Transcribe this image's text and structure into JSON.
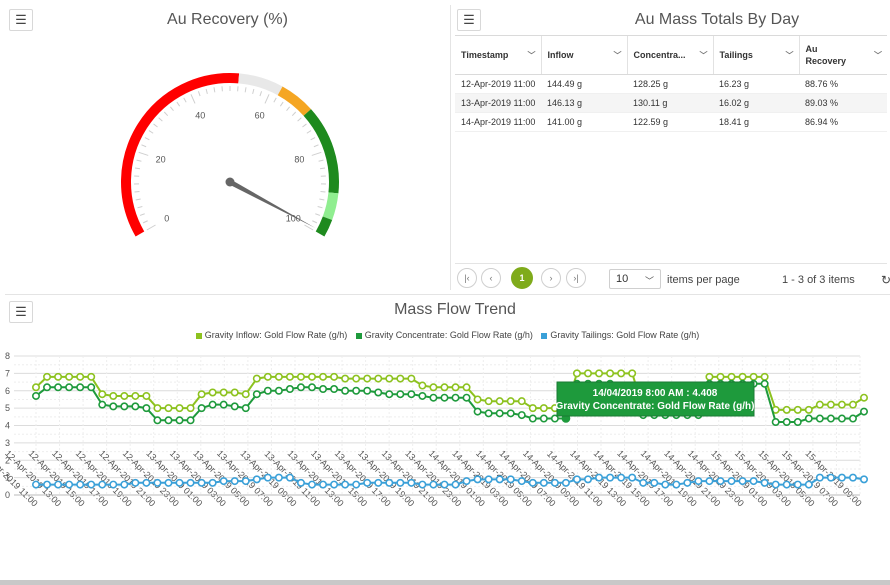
{
  "gauge": {
    "title": "Au Recovery (%)",
    "value": 99.3,
    "min": 0,
    "max": 100,
    "tick_labels": [
      "0",
      "20",
      "40",
      "60",
      "80",
      "100"
    ],
    "bands": [
      {
        "from": 0,
        "to": 52,
        "color": "#ff0000"
      },
      {
        "from": 52,
        "to": 62,
        "color": "#e8e8e8"
      },
      {
        "from": 62,
        "to": 70,
        "color": "#f5a623"
      },
      {
        "from": 70,
        "to": 90,
        "color": "#1e8a1e"
      },
      {
        "from": 90,
        "to": 96,
        "color": "#90ee90"
      },
      {
        "from": 96,
        "to": 100,
        "color": "#1e8a1e"
      }
    ],
    "menu_icon": "hamburger-icon"
  },
  "table": {
    "title": "Au Mass Totals By Day",
    "menu_icon": "hamburger-icon",
    "columns": [
      "Timestamp",
      "Inflow",
      "Concentra...",
      "Tailings",
      "Au Recovery"
    ],
    "rows": [
      [
        "12-Apr-2019 11:00",
        "144.49 g",
        "128.25 g",
        "16.23 g",
        "88.76 %"
      ],
      [
        "13-Apr-2019 11:00",
        "146.13 g",
        "130.11 g",
        "16.02 g",
        "89.03 %"
      ],
      [
        "14-Apr-2019 11:00",
        "141.00 g",
        "122.59 g",
        "18.41 g",
        "86.94 %"
      ]
    ],
    "pager": {
      "first": "|‹",
      "prev": "‹",
      "current": "1",
      "next": "›",
      "last": "›|",
      "page_size": "10",
      "items_per_page": "items per page",
      "count": "1 - 3 of 3 items",
      "refresh": "↻"
    }
  },
  "trend": {
    "title": "Mass Flow Trend",
    "menu_icon": "hamburger-icon",
    "legend": [
      {
        "label": "Gravity Inflow: Gold Flow Rate (g/h)",
        "color": "#8dc21f"
      },
      {
        "label": "Gravity Concentrate: Gold Flow Rate (g/h)",
        "color": "#1e9a3c"
      },
      {
        "label": "Gravity Tailings: Gold Flow Rate (g/h)",
        "color": "#3aa0d8"
      }
    ],
    "tooltip": {
      "line1": "14/04/2019 8:00 AM : 4.408",
      "line2": "Gravity Concentrate: Gold Flow Rate (g/h)",
      "color": "#1e9a3c"
    }
  },
  "chart_data": {
    "type": "line",
    "title": "Mass Flow Trend",
    "ylim": [
      0,
      8
    ],
    "yticks": [
      "0",
      "1",
      "2",
      "3",
      "4",
      "5",
      "6",
      "7",
      "8"
    ],
    "x_tick_labels": [
      "12-Apr-2019 11:00",
      "12-Apr-2019 13:00",
      "12-Apr-2019 15:00",
      "12-Apr-2019 17:00",
      "12-Apr-2019 19:00",
      "12-Apr-2019 21:00",
      "12-Apr-2019 23:00",
      "13-Apr-2019 01:00",
      "13-Apr-2019 03:00",
      "13-Apr-2019 05:00",
      "13-Apr-2019 07:00",
      "13-Apr-2019 09:00",
      "13-Apr-2019 11:00",
      "13-Apr-2019 13:00",
      "13-Apr-2019 15:00",
      "13-Apr-2019 17:00",
      "13-Apr-2019 19:00",
      "13-Apr-2019 21:00",
      "13-Apr-2019 23:00",
      "14-Apr-2019 01:00",
      "14-Apr-2019 03:00",
      "14-Apr-2019 05:00",
      "14-Apr-2019 07:00",
      "14-Apr-2019 09:00",
      "14-Apr-2019 11:00",
      "14-Apr-2019 13:00",
      "14-Apr-2019 15:00",
      "14-Apr-2019 17:00",
      "14-Apr-2019 19:00",
      "14-Apr-2019 21:00",
      "14-Apr-2019 23:00",
      "15-Apr-2019 01:00",
      "15-Apr-2019 03:00",
      "15-Apr-2019 05:00",
      "15-Apr-2019 07:00",
      "15-Apr-2019 09:00"
    ],
    "grid": true,
    "series": [
      {
        "name": "Gravity Inflow: Gold Flow Rate (g/h)",
        "color": "#8dc21f",
        "values": [
          6.2,
          6.8,
          6.8,
          6.8,
          6.8,
          6.8,
          5.8,
          5.7,
          5.7,
          5.7,
          5.7,
          5.0,
          5.0,
          5.0,
          5.0,
          5.8,
          5.9,
          5.9,
          5.9,
          5.8,
          6.7,
          6.8,
          6.8,
          6.8,
          6.8,
          6.8,
          6.8,
          6.8,
          6.7,
          6.7,
          6.7,
          6.7,
          6.7,
          6.7,
          6.7,
          6.3,
          6.2,
          6.2,
          6.2,
          6.2,
          5.5,
          5.4,
          5.4,
          5.4,
          5.4,
          5.0,
          5.0,
          5.0,
          5.0,
          7.0,
          7.0,
          7.0,
          7.0,
          7.0,
          7.0,
          5.0,
          5.0,
          5.0,
          5.0,
          5.0,
          5.0,
          6.8,
          6.8,
          6.8,
          6.8,
          6.8,
          6.8,
          4.9,
          4.9,
          4.9,
          4.9,
          5.2,
          5.2,
          5.2,
          5.2,
          5.6
        ]
      },
      {
        "name": "Gravity Concentrate: Gold Flow Rate (g/h)",
        "color": "#1e9a3c",
        "values": [
          5.7,
          6.2,
          6.2,
          6.2,
          6.2,
          6.2,
          5.2,
          5.1,
          5.1,
          5.1,
          5.0,
          4.3,
          4.3,
          4.3,
          4.3,
          5.0,
          5.2,
          5.2,
          5.1,
          5.0,
          5.8,
          6.0,
          6.0,
          6.1,
          6.2,
          6.2,
          6.1,
          6.1,
          6.0,
          6.0,
          6.0,
          5.9,
          5.8,
          5.8,
          5.8,
          5.7,
          5.6,
          5.6,
          5.6,
          5.6,
          4.8,
          4.7,
          4.7,
          4.7,
          4.6,
          4.4,
          4.4,
          4.4,
          4.408,
          6.4,
          6.4,
          6.4,
          6.4,
          4.8,
          4.8,
          4.6,
          4.6,
          4.6,
          4.6,
          4.6,
          4.6,
          6.4,
          6.4,
          6.4,
          6.4,
          6.4,
          6.4,
          4.2,
          4.2,
          4.2,
          4.4,
          4.4,
          4.4,
          4.4,
          4.4,
          4.8
        ]
      },
      {
        "name": "Gravity Tailings: Gold Flow Rate (g/h)",
        "color": "#3aa0d8",
        "values": [
          0.6,
          0.6,
          0.6,
          0.6,
          0.6,
          0.6,
          0.6,
          0.6,
          0.6,
          0.7,
          0.7,
          0.7,
          0.7,
          0.7,
          0.7,
          0.7,
          0.7,
          0.8,
          0.8,
          0.8,
          0.9,
          1.0,
          1.0,
          1.0,
          0.7,
          0.6,
          0.6,
          0.6,
          0.6,
          0.6,
          0.7,
          0.7,
          0.7,
          0.7,
          0.7,
          0.6,
          0.6,
          0.6,
          0.6,
          0.8,
          0.9,
          0.9,
          0.9,
          0.9,
          0.8,
          0.7,
          0.7,
          0.7,
          0.7,
          0.9,
          0.9,
          1.0,
          1.0,
          1.0,
          1.0,
          0.7,
          0.7,
          0.6,
          0.6,
          0.7,
          0.8,
          0.8,
          0.8,
          0.8,
          0.8,
          0.8,
          0.7,
          0.6,
          0.6,
          0.6,
          0.6,
          1.0,
          1.0,
          1.0,
          1.0,
          0.9
        ]
      }
    ]
  }
}
